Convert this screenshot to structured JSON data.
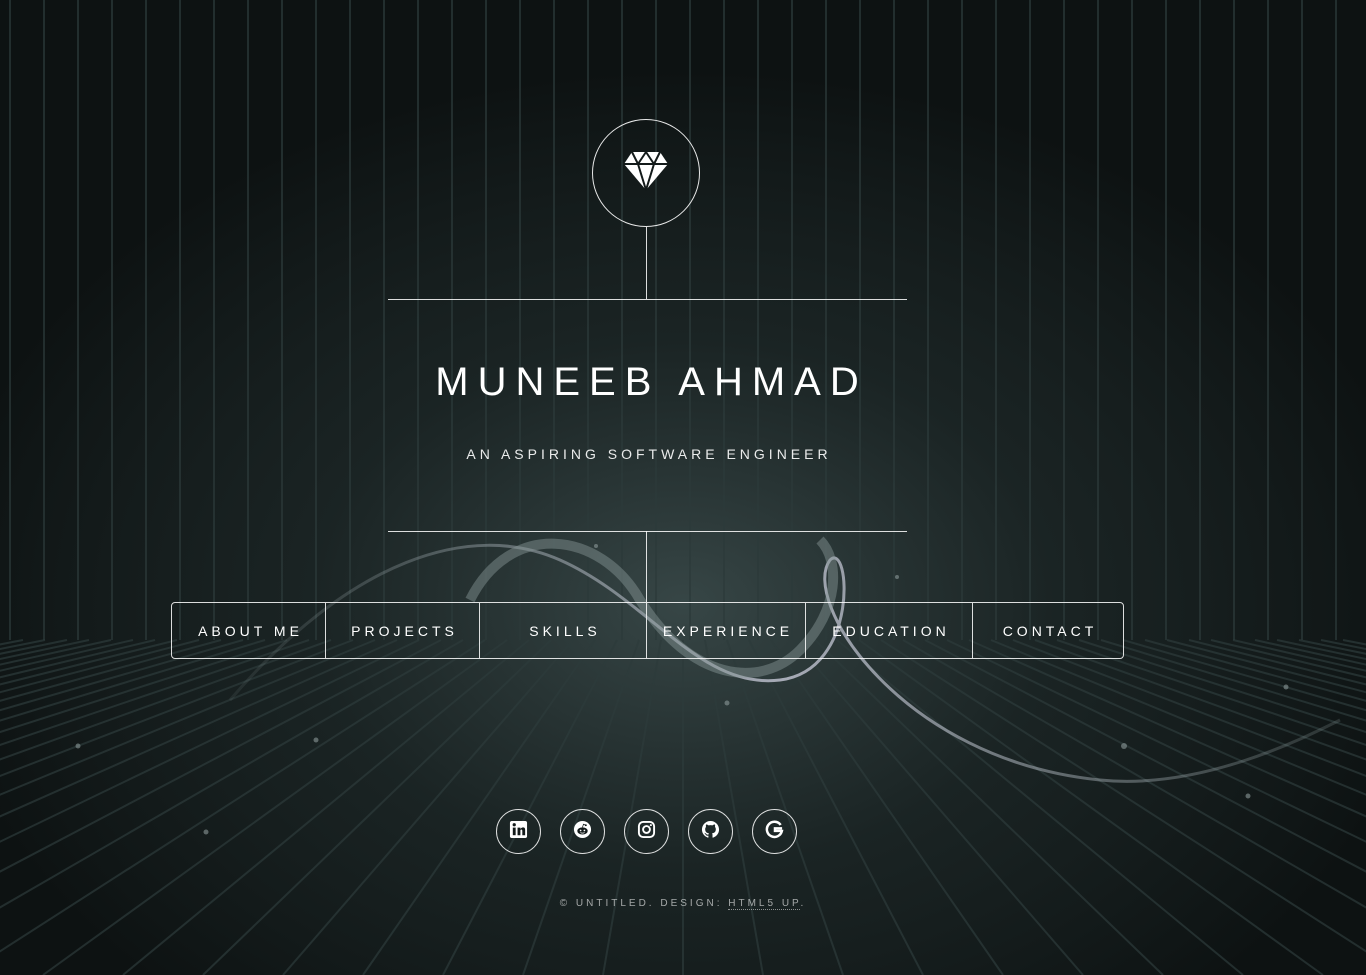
{
  "header": {
    "name": "MUNEEB AHMAD",
    "tagline": "AN ASPIRING SOFTWARE ENGINEER",
    "logo_icon": "diamond-icon"
  },
  "nav": {
    "items": [
      {
        "label": "ABOUT ME"
      },
      {
        "label": "PROJECTS"
      },
      {
        "label": "SKILLS"
      },
      {
        "label": "EXPERIENCE"
      },
      {
        "label": "EDUCATION"
      },
      {
        "label": "CONTACT"
      }
    ]
  },
  "socials": [
    {
      "icon": "linkedin-icon"
    },
    {
      "icon": "reddit-icon"
    },
    {
      "icon": "instagram-icon"
    },
    {
      "icon": "github-icon"
    },
    {
      "icon": "google-icon"
    }
  ],
  "footer": {
    "copyright": "© UNTITLED. DESIGN: ",
    "link": "HTML5 UP",
    "end": "."
  },
  "colors": {
    "background": "#131a1a",
    "foreground": "#ffffff"
  }
}
